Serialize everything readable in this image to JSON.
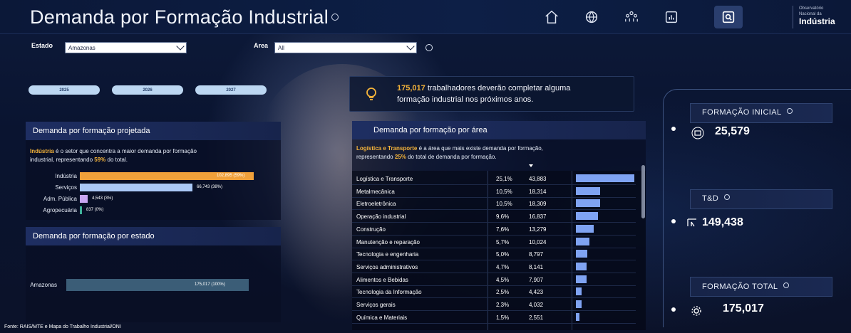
{
  "header": {
    "title": "Demanda por Formação Industrial",
    "brand_small_1": "Observatório",
    "brand_small_2": "Nacional da",
    "brand_big": "Indústria"
  },
  "filters": {
    "estado_label": "Estado",
    "estado_value": "Amazonas",
    "area_label": "Area",
    "area_value": "All"
  },
  "years": [
    "2025",
    "2026",
    "2027"
  ],
  "insight": {
    "highlight": "175,017",
    "text_1": " trabalhadores deverão completar alguma",
    "text_2": "formação industrial nos próximos anos."
  },
  "projetada": {
    "title": "Demanda por formação projetada",
    "note_hl": "Indústria",
    "note_1": " é o setor que concentra a maior demanda por formação",
    "note_2a": "industrial, representando ",
    "note_pct": "59%",
    "note_2b": "  do total.",
    "bars": [
      {
        "label": "Indústria",
        "value": 102895,
        "text": "102,895 (59%)",
        "color": "#f0a03a"
      },
      {
        "label": "Serviços",
        "value": 66743,
        "text": "66,743 (38%)",
        "color": "#aac8f7"
      },
      {
        "label": "Adm. Pública",
        "value": 4543,
        "text": "4,543 (3%)",
        "color": "#c9a6f2"
      },
      {
        "label": "Agropecuária",
        "value": 837,
        "text": "837 (0%)",
        "color": "#3fb29a"
      }
    ]
  },
  "estado": {
    "title": "Demanda por formação por estado",
    "bars": [
      {
        "label": "Amazonas",
        "value": 175017,
        "text": "175,017 (100%)",
        "color": "#3b5d77"
      }
    ]
  },
  "area": {
    "title": "Demanda por formação por área",
    "note_hl": "Logística e Transporte",
    "note_1": " é a área que mais existe demanda por formação,",
    "note_2a": "representando ",
    "note_pct": "25%",
    "note_2b": " do total de demanda por formação.",
    "rows": [
      {
        "name": "Logística e Transporte",
        "pct": "25,1%",
        "value": 43883,
        "value_text": "43,883"
      },
      {
        "name": "Metalmecânica",
        "pct": "10,5%",
        "value": 18314,
        "value_text": "18,314"
      },
      {
        "name": "Eletroeletrônica",
        "pct": "10,5%",
        "value": 18309,
        "value_text": "18,309"
      },
      {
        "name": "Operação industrial",
        "pct": "9,6%",
        "value": 16837,
        "value_text": "16,837"
      },
      {
        "name": "Construção",
        "pct": "7,6%",
        "value": 13279,
        "value_text": "13,279"
      },
      {
        "name": "Manutenção e reparação",
        "pct": "5,7%",
        "value": 10024,
        "value_text": "10,024"
      },
      {
        "name": "Tecnologia e engenharia",
        "pct": "5,0%",
        "value": 8797,
        "value_text": "8,797"
      },
      {
        "name": "Serviços administrativos",
        "pct": "4,7%",
        "value": 8141,
        "value_text": "8,141"
      },
      {
        "name": "Alimentos e Bebidas",
        "pct": "4,5%",
        "value": 7907,
        "value_text": "7,907"
      },
      {
        "name": "Tecnologia da Informação",
        "pct": "2,5%",
        "value": 4423,
        "value_text": "4,423"
      },
      {
        "name": "Serviços gerais",
        "pct": "2,3%",
        "value": 4032,
        "value_text": "4,032"
      },
      {
        "name": "Química e Materiais",
        "pct": "1,5%",
        "value": 2551,
        "value_text": "2,551"
      }
    ]
  },
  "kpis": {
    "inicial_label": "FORMAÇÃO INICIAL",
    "inicial_value": "25,579",
    "td_label": "T&D",
    "td_value": "149,438",
    "total_label": "FORMAÇÃO TOTAL",
    "total_value": "175,017"
  },
  "source": "Fonte: RAIS/MTE e Mapa do Trabalho Industrial/ONI"
}
